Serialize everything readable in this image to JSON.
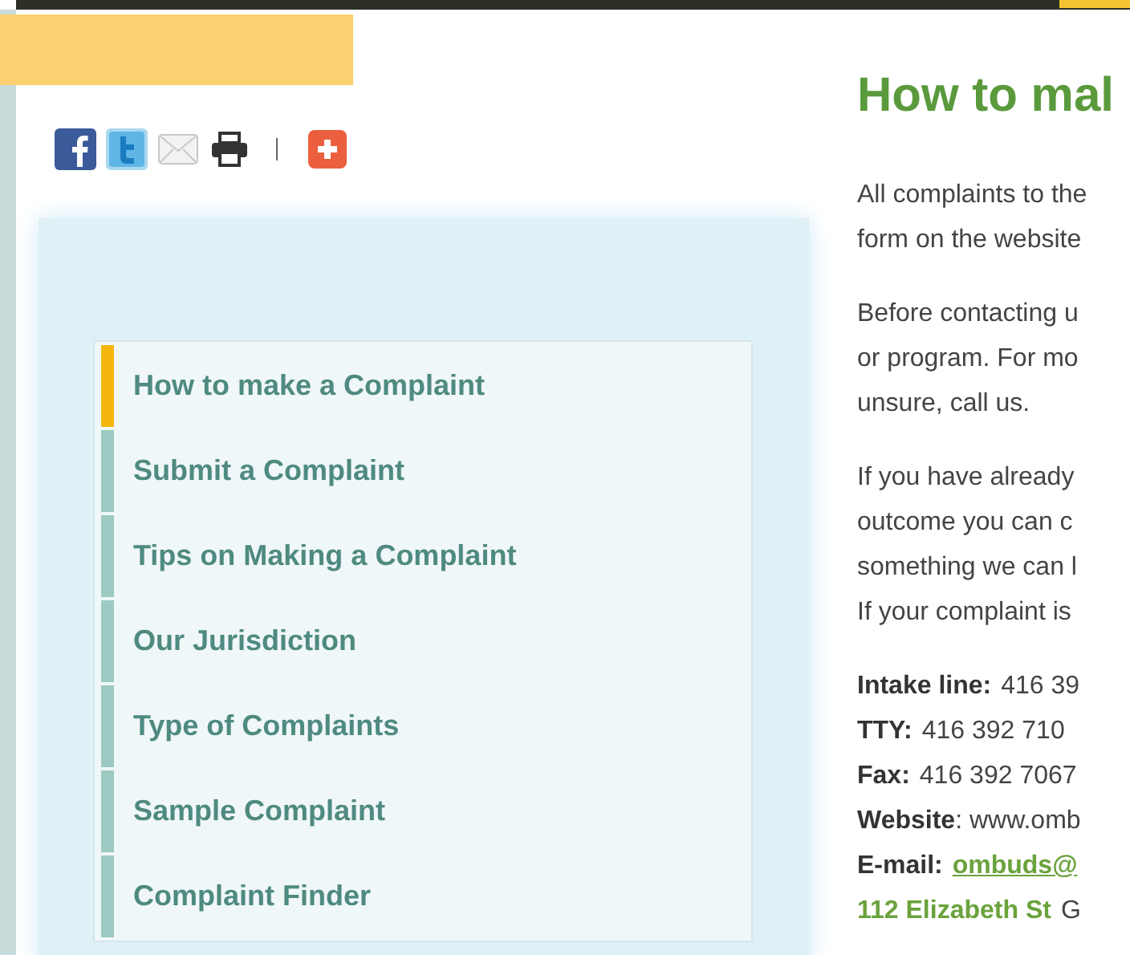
{
  "sidebar": {
    "items": [
      {
        "label": "How to make a Complaint",
        "selected": true
      },
      {
        "label": "Submit a Complaint",
        "selected": false
      },
      {
        "label": "Tips on Making a Complaint",
        "selected": false
      },
      {
        "label": "Our Jurisdiction",
        "selected": false
      },
      {
        "label": "Type of Complaints",
        "selected": false
      },
      {
        "label": "Sample Complaint",
        "selected": false
      },
      {
        "label": "Complaint Finder",
        "selected": false
      }
    ]
  },
  "content": {
    "heading": "How to mal",
    "paragraphs": [
      {
        "lines": [
          "All complaints to the",
          "form on the website"
        ]
      },
      {
        "lines": [
          "Before contacting u",
          "or program. For mo",
          "unsure, call us."
        ]
      },
      {
        "lines": [
          "If you have already",
          "outcome you can c",
          "something we can l",
          "If your complaint is"
        ]
      }
    ],
    "contacts": [
      {
        "parts": [
          {
            "kind": "label",
            "text": "Intake line:"
          },
          {
            "kind": "text",
            "text": "416 39"
          }
        ]
      },
      {
        "parts": [
          {
            "kind": "label",
            "text": "TTY:"
          },
          {
            "kind": "text",
            "text": "416 392 710"
          }
        ]
      },
      {
        "parts": [
          {
            "kind": "label",
            "text": "Fax:"
          },
          {
            "kind": "text",
            "text": "416 392 7067"
          }
        ]
      },
      {
        "parts": [
          {
            "kind": "rich",
            "text": "**Website**: www.omb"
          }
        ]
      },
      {
        "parts": [
          {
            "kind": "label",
            "text": "E-mail:"
          },
          {
            "kind": "link",
            "text": "ombuds@"
          }
        ]
      },
      {
        "parts": [
          {
            "kind": "strong_link",
            "text": "112 Elizabeth St"
          },
          {
            "kind": "text",
            "text": "G"
          }
        ]
      }
    ]
  }
}
